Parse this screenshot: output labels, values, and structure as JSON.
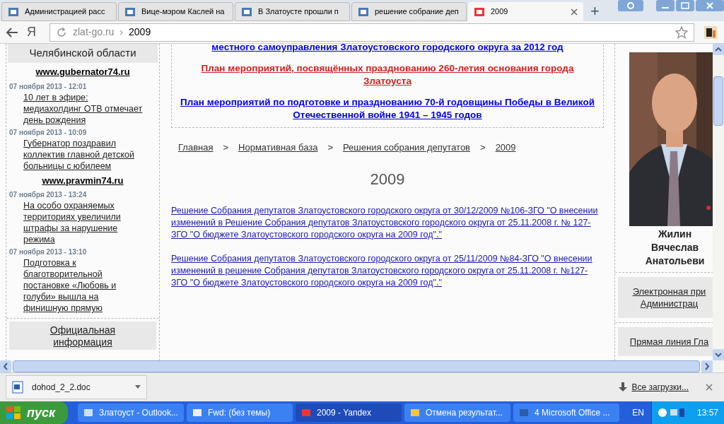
{
  "browser": {
    "tabs": [
      {
        "title": "Администрацией расс",
        "selected": false
      },
      {
        "title": "Вице-мэром Каслей на",
        "selected": false
      },
      {
        "title": "В Златоусте прошли п",
        "selected": false
      },
      {
        "title": "решение собрание деп",
        "selected": false
      },
      {
        "title": "2009",
        "selected": true
      }
    ],
    "new_tab_button": "+",
    "home_button": "Я",
    "address": {
      "domain": "zlat-go.ru",
      "separator": "›",
      "path": "2009"
    }
  },
  "left_sidebar": {
    "region_title": "Челябинской области",
    "news_groups": [
      {
        "source": "www.gubernator74.ru",
        "items": [
          {
            "date": "07 ноября 2013 - 12:01",
            "title": "10 лет в эфире: медиахолдинг ОТВ отмечает день рождения"
          },
          {
            "date": "07 ноября 2013 - 10:09",
            "title": "Губернатор поздравил коллектив главной детской больницы с юбилеем"
          }
        ]
      },
      {
        "source": "www.pravmin74.ru",
        "items": [
          {
            "date": "07 ноября 2013 - 13:24",
            "title": "На особо охраняемых территориях увеличили штрафы за нарушение режима"
          },
          {
            "date": "07 ноября 2013 - 13:10",
            "title": "Подготовка к благотворительной постановке «Любовь и голуби» вышла на финишную прямую"
          }
        ]
      }
    ],
    "box_link": "Официальная информация"
  },
  "main": {
    "featured_links": [
      {
        "text": "местного самоуправления Златоустовского городского округа за 2012 год",
        "color": "#0000ee"
      },
      {
        "text": "План мероприятий, посвящённых празднованию 260-летия основания города Златоуста",
        "color": "#d42020"
      },
      {
        "text": "План мероприятий по подготовке и празднованию 70-й годовщины Победы в Великой Отечественной войне 1941 – 1945 годов",
        "color": "#0000ee"
      }
    ],
    "breadcrumbs": [
      "Главная",
      "Нормативная база",
      "Решения собрания депутатов",
      "2009"
    ],
    "breadcrumb_separator": ">",
    "heading": "2009",
    "documents": [
      "Решение Собрания депутатов Златоустовского городского округа от 30/12/2009 №106-ЗГО \"О внесении изменений в Решение Собрания депутатов Златоустовского городского округа от 25.11.2008 г. № 127-ЗГО \"О бюджете Златоустовского городского округа на 2009 год\".\"",
      "Решение Собрания депутатов Златоустовского городского округа от 25/11/2009 №84-ЗГО \"О внесении изменений в решение Собрания депутатов Златоустовского городского округа от 25.11.2008 г. №127-ЗГО \"О бюджете Златоустовского городского округа на 2009 год\".\""
    ]
  },
  "right_sidebar": {
    "photo": {
      "kind": "picture"
    },
    "name_lines": [
      "Жилин",
      "Вячеслав",
      "Анатольеви"
    ],
    "links": [
      [
        "Электронная при",
        "Администрац"
      ],
      [
        "Прямая линия Гла"
      ]
    ]
  },
  "downloads": {
    "file": "dohod_2_2.doc",
    "all_link": "Все загрузки..."
  },
  "taskbar": {
    "start": "пуск",
    "tasks": [
      {
        "title": "Златоуст - Outlook...",
        "selected": false
      },
      {
        "title": "Fwd: (без темы)",
        "selected": false
      },
      {
        "title": "2009 - Yandex",
        "selected": true
      },
      {
        "title": "Отмена результат...",
        "selected": false
      },
      {
        "title": "4 Microsoft Office ...",
        "selected": false
      }
    ],
    "language": "EN",
    "clock": "13:57"
  }
}
